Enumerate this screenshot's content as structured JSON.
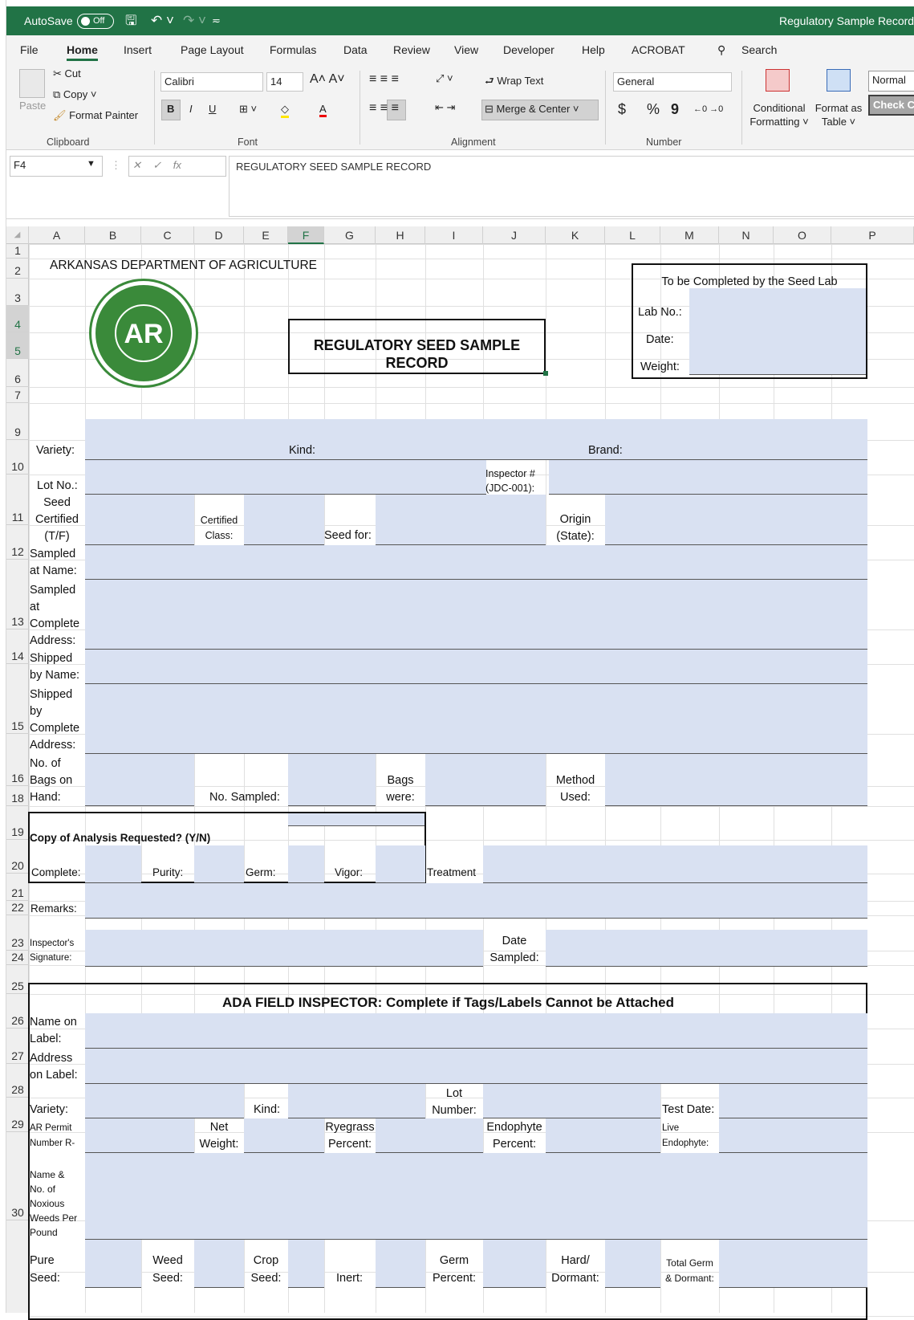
{
  "titlebar": {
    "autosave_label": "AutoSave",
    "autosave_state": "Off",
    "doc_title": "Regulatory Sample Record  -"
  },
  "menu": [
    "File",
    "Home",
    "Insert",
    "Page Layout",
    "Formulas",
    "Data",
    "Review",
    "View",
    "Developer",
    "Help",
    "ACROBAT"
  ],
  "search_label": "Search",
  "ribbon": {
    "paste": "Paste",
    "cut": "Cut",
    "copy": "Copy",
    "format_painter": "Format Painter",
    "group_clipboard": "Clipboard",
    "font_name": "Calibri",
    "font_size": "14",
    "bold": "B",
    "italic": "I",
    "underline": "U",
    "group_font": "Font",
    "wrap_text": "Wrap Text",
    "merge_center": "Merge & Center",
    "group_alignment": "Alignment",
    "number_format": "General",
    "currency": "$",
    "percent": "%",
    "comma": "9",
    "group_number": "Number",
    "conditional_1": "Conditional",
    "conditional_2": "Formatting",
    "format_table_1": "Format as",
    "format_table_2": "Table",
    "style_normal": "Normal",
    "style_check": "Check Ce"
  },
  "formula_bar": {
    "name_box": "F4",
    "fx": "fx",
    "content": "REGULATORY SEED SAMPLE RECORD"
  },
  "columns": [
    "A",
    "B",
    "C",
    "D",
    "E",
    "F",
    "G",
    "H",
    "I",
    "J",
    "K",
    "L",
    "M",
    "N",
    "O",
    "P"
  ],
  "rows": [
    "1",
    "2",
    "3",
    "4",
    "5",
    "6",
    "7",
    "9",
    "10",
    "11",
    "12",
    "13",
    "14",
    "15",
    "16",
    "18",
    "19",
    "20",
    "21",
    "22",
    "23",
    "24",
    "25",
    "26",
    "27",
    "28",
    "29",
    "30"
  ],
  "logo_text": "AR",
  "sheet": {
    "agency": "ARKANSAS DEPARTMENT OF AGRICULTURE",
    "form_title": "REGULATORY SEED SAMPLE RECORD",
    "lab_header": "To be Completed by the Seed Lab",
    "lab_no": "Lab No.:",
    "lab_date": "Date:",
    "lab_weight": "Weight:",
    "variety": "Variety:",
    "kind": "Kind:",
    "brand": "Brand:",
    "lot_no": "Lot No.:",
    "inspector_1": "Inspector #",
    "inspector_2": "(JDC-001):",
    "seed_cert_1": "Seed",
    "seed_cert_2": "Certified",
    "seed_cert_3": "(T/F)",
    "cert_class_1": "Certified",
    "cert_class_2": "Class:",
    "seed_for": "Seed for:",
    "origin_1": "Origin",
    "origin_2": "(State):",
    "sampled_name_1": "Sampled",
    "sampled_name_2": "at Name:",
    "sampled_addr_1": "Sampled",
    "sampled_addr_2": "at",
    "sampled_addr_3": "Complete",
    "sampled_addr_4": "Address:",
    "shipped_name_1": "Shipped",
    "shipped_name_2": "by Name:",
    "shipped_addr_1": "Shipped",
    "shipped_addr_2": "by",
    "shipped_addr_3": "Complete",
    "shipped_addr_4": "Address:",
    "bags_1": "No. of",
    "bags_2": "Bags on",
    "bags_3": "Hand:",
    "no_sampled": "No. Sampled:",
    "bags_were_1": "Bags",
    "bags_were_2": "were:",
    "method_1": "Method",
    "method_2": "Used:",
    "copy_req": "Copy of Analysis Requested? (Y/N)",
    "complete": "Complete:",
    "purity": "Purity:",
    "germ": "Germ:",
    "vigor": "Vigor:",
    "treatment": "Treatment",
    "remarks": "Remarks:",
    "insp_sig_1": "Inspector's",
    "insp_sig_2": "Signature:",
    "date_sampled_1": "Date",
    "date_sampled_2": "Sampled:",
    "field_header": "ADA FIELD INSPECTOR:  Complete if Tags/Labels Cannot be Attached",
    "name_label_1": "Name on",
    "name_label_2": "Label:",
    "addr_label_1": "Address",
    "addr_label_2": "on Label:",
    "variety2": "Variety:",
    "kind2": "Kind:",
    "lot_num_1": "Lot",
    "lot_num_2": "Number:",
    "test_date": "Test Date:",
    "permit_1": "AR Permit",
    "permit_2": "Number R-",
    "net_1": "Net",
    "net_2": "Weight:",
    "rye_1": "Ryegrass",
    "rye_2": "Percent:",
    "endo_1": "Endophyte",
    "endo_2": "Percent:",
    "live_1": "Live",
    "live_2": "Endophyte:",
    "weeds_1": "Name &",
    "weeds_2": "No. of",
    "weeds_3": "Noxious",
    "weeds_4": "Weeds Per",
    "weeds_5": "Pound",
    "pure_1": "Pure",
    "pure_2": "Seed:",
    "weed_1": "Weed",
    "weed_2": "Seed:",
    "crop_1": "Crop",
    "crop_2": "Seed:",
    "inert": "Inert:",
    "germp_1": "Germ",
    "germp_2": "Percent:",
    "hard_1": "Hard/",
    "hard_2": "Dormant:",
    "tg_1": "Total Germ",
    "tg_2": "& Dormant:"
  },
  "colors": {
    "excel_green": "#217346",
    "input_fill": "#d9e1f2",
    "logo_green": "#3a8a3a"
  }
}
